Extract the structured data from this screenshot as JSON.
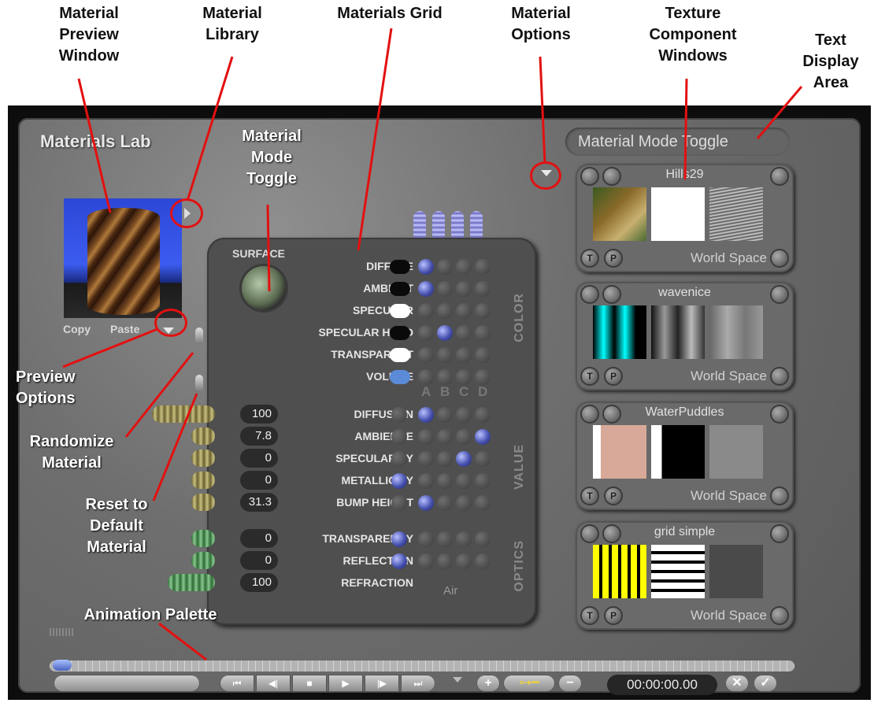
{
  "callouts": {
    "preview_window": "Material\nPreview\nWindow",
    "library": "Material\nLibrary",
    "grid": "Materials Grid",
    "options": "Material\nOptions",
    "texture": "Texture\nComponent\nWindows",
    "text_area": "Text\nDisplay\nArea",
    "mode_toggle": "Material\nMode\nToggle",
    "preview_options": "Preview\nOptions",
    "randomize": "Randomize\nMaterial",
    "reset": "Reset to\nDefault\nMaterial",
    "animation": "Animation Palette"
  },
  "panel": {
    "title": "Materials Lab",
    "text_display": "Material Mode Toggle"
  },
  "preview": {
    "copy": "Copy",
    "paste": "Paste"
  },
  "surface_label": "SURFACE",
  "color_rows": [
    {
      "name": "DIFFUSE",
      "swatch": "#0a0a0a"
    },
    {
      "name": "AMBIENT",
      "swatch": "#0a0a0a"
    },
    {
      "name": "SPECULAR",
      "swatch": "#ffffff"
    },
    {
      "name": "SPECULAR HALO",
      "swatch": "#0a0a0a"
    },
    {
      "name": "TRANSPARENT",
      "swatch": "#ffffff"
    },
    {
      "name": "VOLUME",
      "swatch": "#5a8ad8"
    }
  ],
  "value_rows": [
    {
      "name": "DIFFUSION",
      "value": "100"
    },
    {
      "name": "AMBIENCE",
      "value": "7.8"
    },
    {
      "name": "SPECULARITY",
      "value": "0"
    },
    {
      "name": "METALLICITY",
      "value": "0"
    },
    {
      "name": "BUMP HEIGHT",
      "value": "31.3"
    }
  ],
  "optic_rows": [
    {
      "name": "TRANSPARENCY",
      "value": "0"
    },
    {
      "name": "REFLECTION",
      "value": "0"
    },
    {
      "name": "REFRACTION",
      "value": "100"
    }
  ],
  "refraction_medium": "Air",
  "column_letters": [
    "A",
    "B",
    "C",
    "D"
  ],
  "sections": {
    "color": "COLOR",
    "value": "VALUE",
    "optics": "OPTICS"
  },
  "textures": [
    {
      "name": "Hills29",
      "space": "World Space"
    },
    {
      "name": "wavenice",
      "space": "World Space"
    },
    {
      "name": "WaterPuddles",
      "space": "World Space"
    },
    {
      "name": "grid simple",
      "space": "World Space"
    }
  ],
  "texture_buttons": {
    "t": "T",
    "p": "P"
  },
  "timecode": "00:00:00.00",
  "colors": {
    "accent_red": "#e31010",
    "grid_dot_on": "#4752b0"
  }
}
